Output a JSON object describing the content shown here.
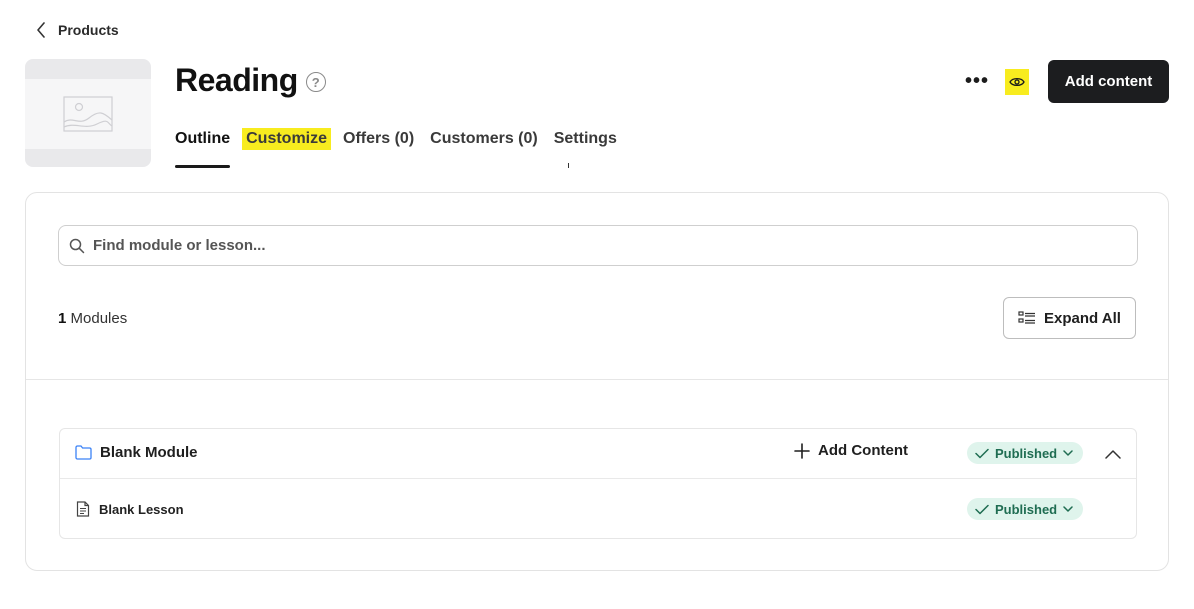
{
  "breadcrumb": {
    "label": "Products"
  },
  "product": {
    "title": "Reading"
  },
  "tabs": [
    {
      "label": "Outline"
    },
    {
      "label": "Customize"
    },
    {
      "label": "Offers (0)"
    },
    {
      "label": "Customers (0)"
    },
    {
      "label": "Settings"
    }
  ],
  "header": {
    "more_label": "•••",
    "add_content_label": "Add content"
  },
  "search": {
    "placeholder": "Find module or lesson..."
  },
  "modules": {
    "count": "1",
    "count_suffix": " Modules",
    "expand_all_label": "Expand All"
  },
  "module": {
    "name": "Blank Module",
    "add_content_label": "Add Content",
    "status": "Published",
    "lessons": [
      {
        "name": "Blank Lesson",
        "status": "Published"
      }
    ]
  },
  "colors": {
    "highlight": "#f8ec1f",
    "primary_button": "#1c1d1f",
    "published_bg": "#dff4ec",
    "published_text": "#1f6d52",
    "folder_icon": "#3b82f6"
  }
}
